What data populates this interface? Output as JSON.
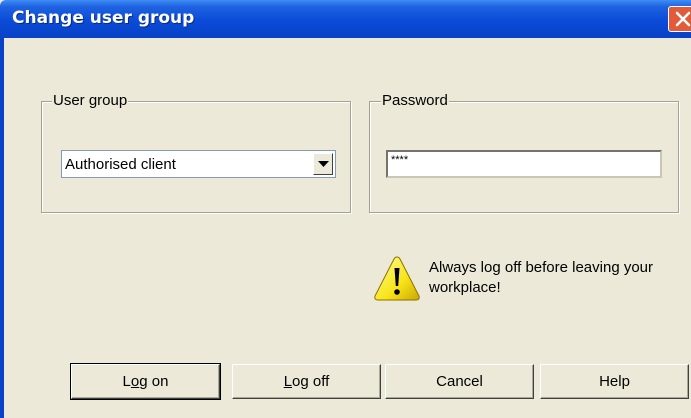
{
  "window": {
    "title": "Change user group"
  },
  "user_group": {
    "legend": "User group",
    "selected": "Authorised client"
  },
  "password": {
    "legend": "Password",
    "value": "****"
  },
  "warning": {
    "text": "Always log off before leaving your workplace!"
  },
  "buttons": {
    "logon_first": "L",
    "logon_mnemonic": "o",
    "logon_rest": "g on",
    "logoff_mnemonic": "L",
    "logoff_rest": "og off",
    "cancel": "Cancel",
    "help": "Help"
  },
  "colors": {
    "titlebar": "#0a4bd8",
    "dialog_bg": "#ece9d8",
    "close": "#e25a37",
    "warning_yellow": "#f8e418"
  }
}
